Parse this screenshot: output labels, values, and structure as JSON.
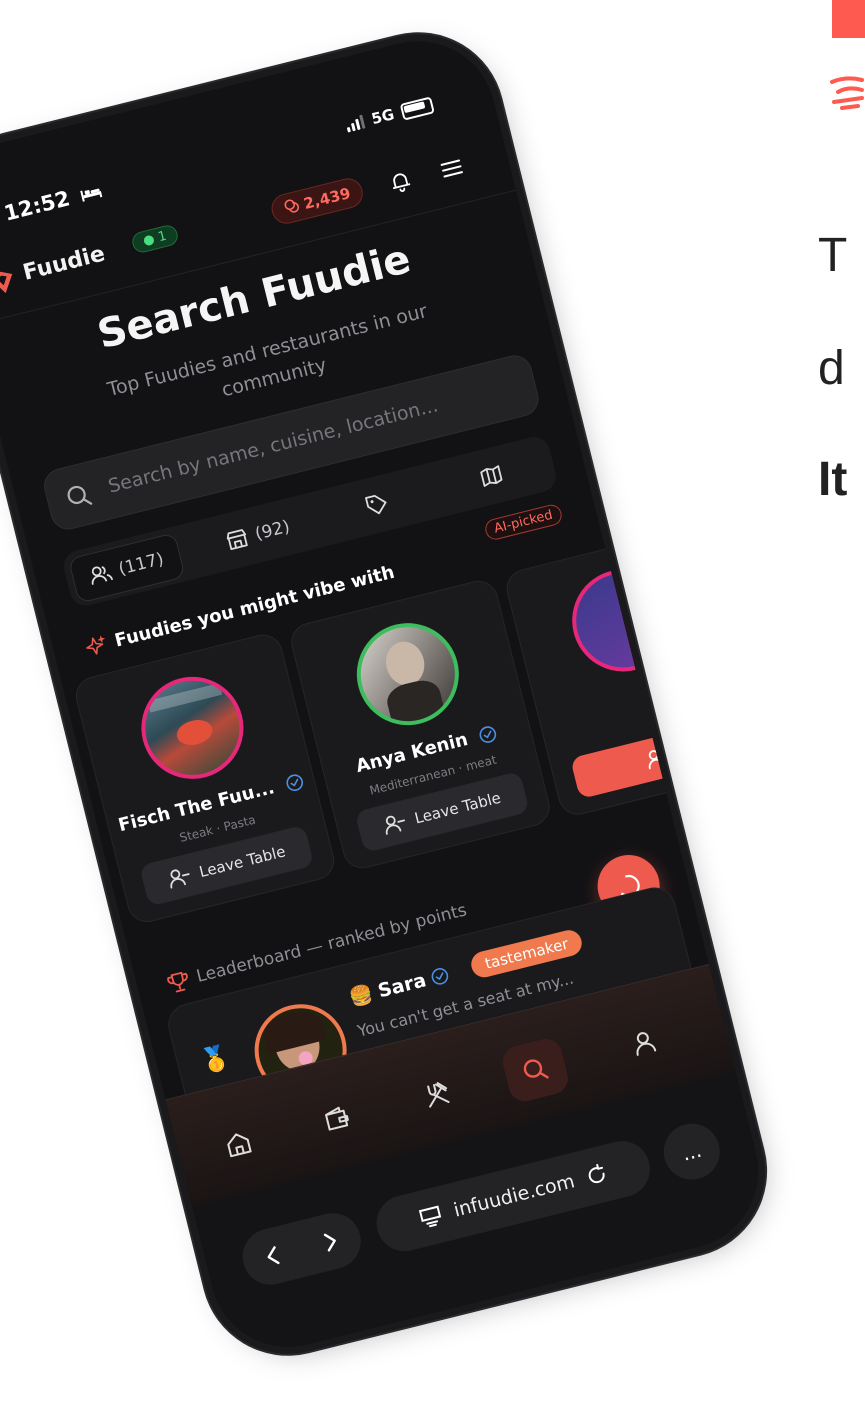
{
  "status_bar": {
    "time": "12:52",
    "network": "5G"
  },
  "header": {
    "brand": "Fuudie",
    "level": "1",
    "points": "2,439"
  },
  "hero": {
    "title": "Search Fuudie",
    "subtitle": "Top Fuudies and restaurants in our community"
  },
  "search": {
    "placeholder": "Search by name, cuisine, location..."
  },
  "tabs": [
    {
      "label": "(117)",
      "icon": "users-icon",
      "active": true
    },
    {
      "label": "(92)",
      "icon": "store-icon",
      "active": false
    },
    {
      "label": "",
      "icon": "tag-icon",
      "active": false
    },
    {
      "label": "",
      "icon": "map-icon",
      "active": false
    }
  ],
  "suggestions": {
    "title": "Fuudies you might vibe with",
    "badge": "AI-picked",
    "cards": [
      {
        "name": "Fisch The Fuu...",
        "sub": "Steak · Pasta",
        "button": "Leave Table"
      },
      {
        "name": "Anya Kenin",
        "sub": "Mediterranean · meat",
        "button": "Leave Table"
      }
    ]
  },
  "leaderboard": {
    "title": "Leaderboard — ranked by points",
    "rows": [
      {
        "name": "Sara",
        "badge": "tastemaker",
        "message": "You can't get a seat at my..."
      }
    ]
  },
  "bottom_nav": [
    "home-icon",
    "wallet-icon",
    "utensils-icon",
    "search-icon",
    "profile-icon"
  ],
  "browser": {
    "url": "infuudie.com",
    "more": "..."
  },
  "promo": {
    "line1": "T",
    "line2": "d",
    "line3": "It"
  },
  "colors": {
    "accent": "#ef5a4e",
    "background": "#121214",
    "card": "#1a1a1d",
    "success": "#4ade80"
  }
}
